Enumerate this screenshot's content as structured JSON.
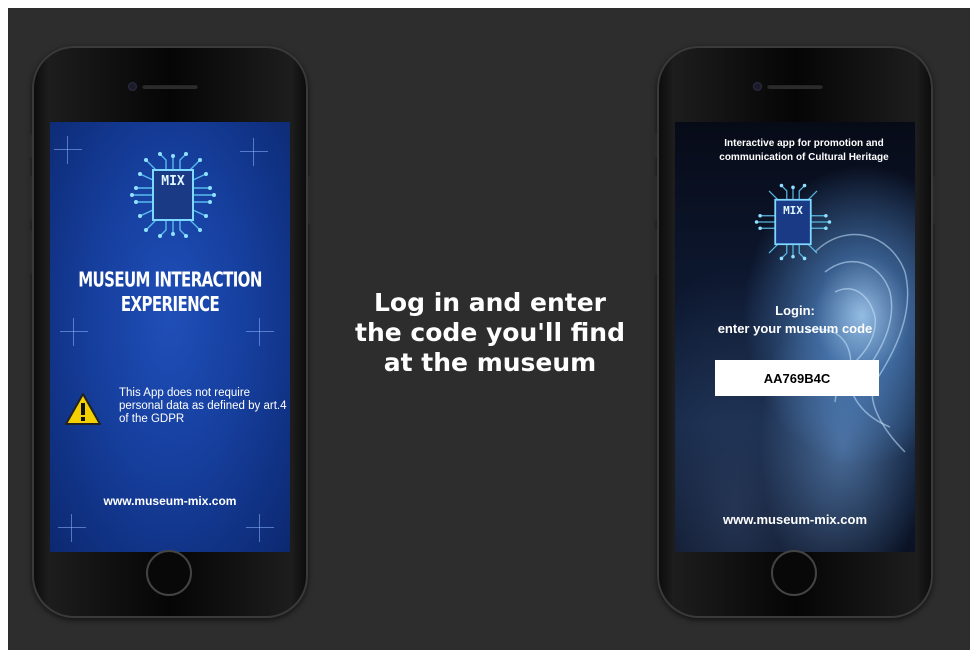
{
  "headline": {
    "line1": "Log in and enter",
    "line2": "the code you'll find",
    "line3": "at the museum"
  },
  "left_phone": {
    "logo_text": "MIX",
    "title": "MUSEUM INTERACTION EXPERIENCE",
    "warning_icon": "warning-triangle-icon",
    "gdpr_notice": "This App does not require personal data as defined by art.4 of the GDPR",
    "url": "www.museum-mix.com"
  },
  "right_phone": {
    "promo_line1": "Interactive app for promotion and",
    "promo_line2": "communication of Cultural Heritage",
    "logo_text": "MIX",
    "login_label": "Login:",
    "login_prompt": "enter your museum code",
    "code_value": "AA769B4C",
    "url": "www.museum-mix.com"
  },
  "colors": {
    "background": "#2d2d2d",
    "left_screen": "#163f9e",
    "logo_glow": "#7fd8ff",
    "warning": "#f5d000"
  }
}
